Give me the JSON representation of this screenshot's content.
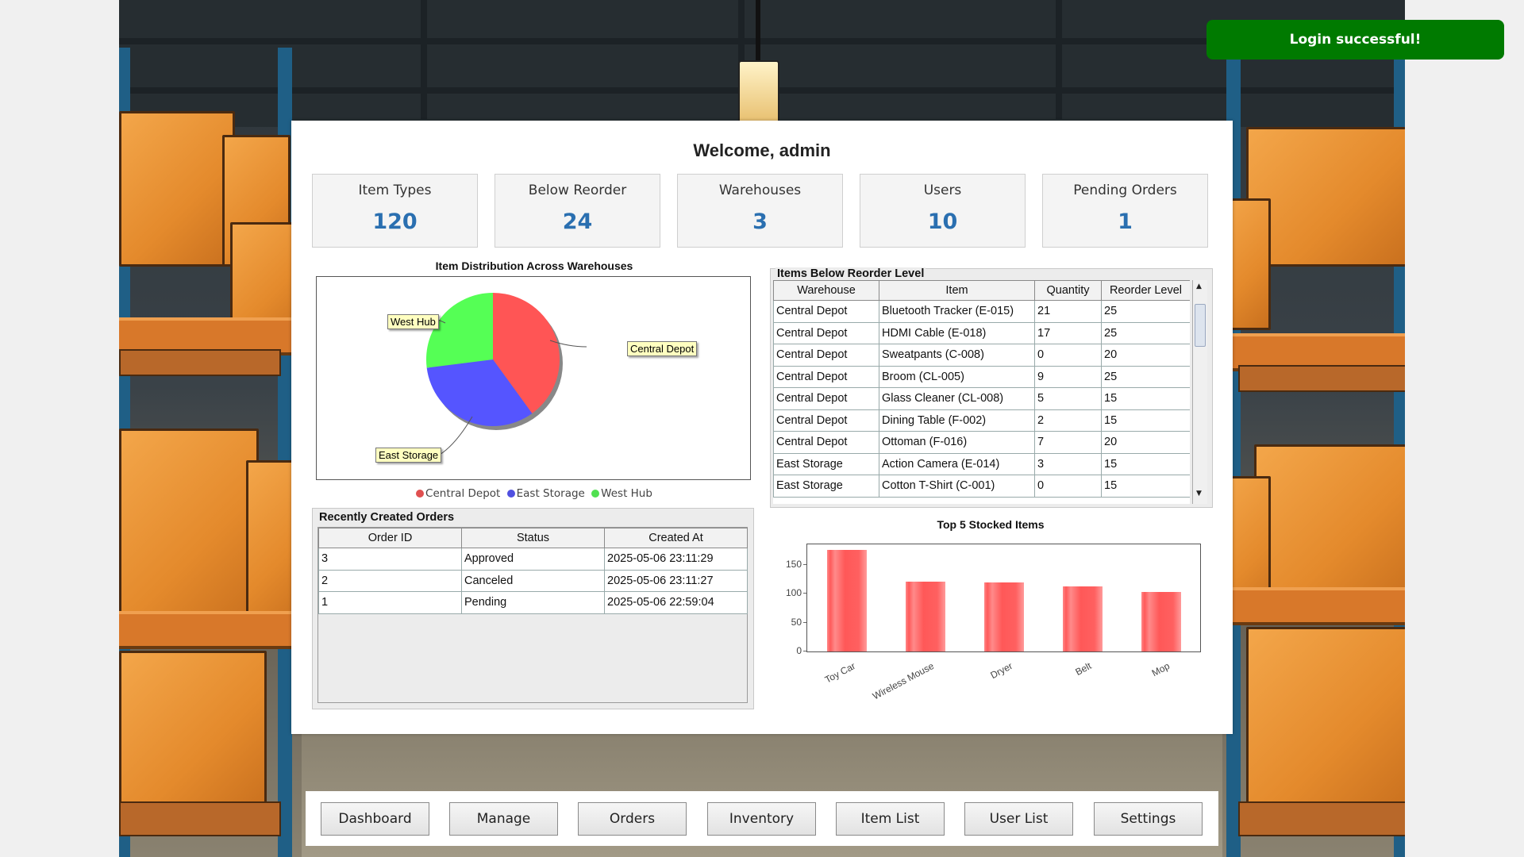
{
  "toast": {
    "text": "Login successful!",
    "color": "#007a00"
  },
  "header": {
    "welcome": "Welcome, admin"
  },
  "stats": [
    {
      "label": "Item Types",
      "value": "120"
    },
    {
      "label": "Below Reorder",
      "value": "24"
    },
    {
      "label": "Warehouses",
      "value": "3"
    },
    {
      "label": "Users",
      "value": "10"
    },
    {
      "label": "Pending Orders",
      "value": "1"
    }
  ],
  "pie_chart": {
    "title": "Item Distribution Across Warehouses",
    "labels": [
      "Central Depot",
      "East Storage",
      "West Hub"
    ],
    "legend": [
      "Central Depot",
      "East Storage",
      "West Hub"
    ],
    "colors": [
      "#ff5555",
      "#5555ff",
      "#55ff55"
    ]
  },
  "reorder": {
    "title": "Items Below Reorder Level",
    "columns": [
      "Warehouse",
      "Item",
      "Quantity",
      "Reorder Level"
    ],
    "rows": [
      [
        "Central Depot",
        "Bluetooth Tracker (E-015)",
        "21",
        "25"
      ],
      [
        "Central Depot",
        "HDMI Cable (E-018)",
        "17",
        "25"
      ],
      [
        "Central Depot",
        "Sweatpants (C-008)",
        "0",
        "20"
      ],
      [
        "Central Depot",
        "Broom (CL-005)",
        "9",
        "25"
      ],
      [
        "Central Depot",
        "Glass Cleaner (CL-008)",
        "5",
        "15"
      ],
      [
        "Central Depot",
        "Dining Table (F-002)",
        "2",
        "15"
      ],
      [
        "Central Depot",
        "Ottoman (F-016)",
        "7",
        "20"
      ],
      [
        "East Storage",
        "Action Camera (E-014)",
        "3",
        "15"
      ],
      [
        "East Storage",
        "Cotton T-Shirt (C-001)",
        "0",
        "15"
      ]
    ]
  },
  "orders": {
    "title": "Recently Created Orders",
    "columns": [
      "Order ID",
      "Status",
      "Created At"
    ],
    "rows": [
      [
        "3",
        "Approved",
        "2025-05-06 23:11:29"
      ],
      [
        "2",
        "Canceled",
        "2025-05-06 23:11:27"
      ],
      [
        "1",
        "Pending",
        "2025-05-06 22:59:04"
      ]
    ]
  },
  "chart_data": [
    {
      "type": "pie",
      "title": "Item Distribution Across Warehouses",
      "categories": [
        "Central Depot",
        "East Storage",
        "West Hub"
      ],
      "values": [
        40,
        33,
        27
      ],
      "colors": [
        "#ff5555",
        "#5555ff",
        "#55ff55"
      ],
      "legend": "bottom"
    },
    {
      "type": "bar",
      "title": "Top 5 Stocked Items",
      "categories": [
        "Toy Car",
        "Wireless Mouse",
        "Dryer",
        "Belt",
        "Mop"
      ],
      "values": [
        176,
        121,
        120,
        113,
        104
      ],
      "ylim": [
        0,
        186
      ],
      "yticks": [
        "0",
        "50",
        "100",
        "150"
      ],
      "color": "#ff5555",
      "grid": false
    }
  ],
  "nav": {
    "buttons": [
      "Dashboard",
      "Manage",
      "Orders",
      "Inventory",
      "Item List",
      "User List",
      "Settings"
    ]
  }
}
